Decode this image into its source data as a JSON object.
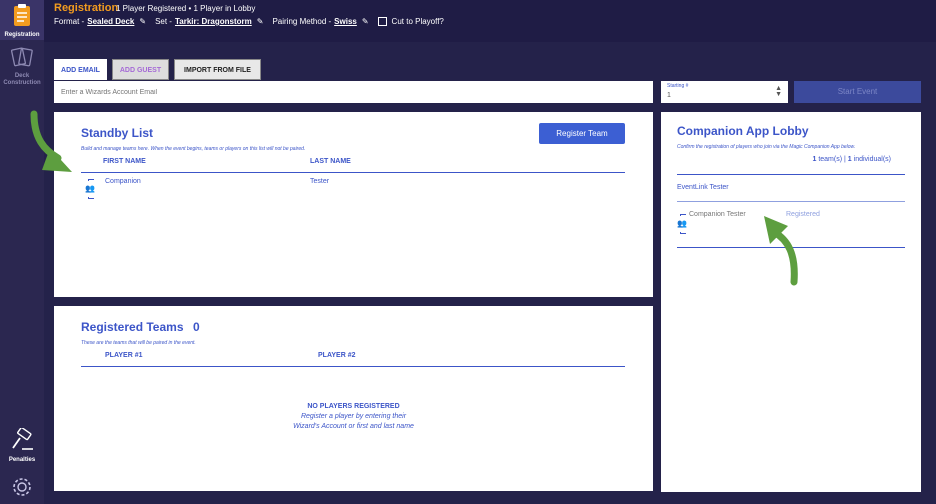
{
  "sidebar": {
    "registration_label": "Registration",
    "deck_label_1": "Deck",
    "deck_label_2": "Construction",
    "penalties_label": "Penalties",
    "icons": [
      "clipboard-icon",
      "cards-icon",
      "gavel-icon",
      "gear-icon"
    ]
  },
  "header": {
    "title": "Registration",
    "subtitle": "1 Player Registered • 1 Player in Lobby",
    "format_label": "Format -",
    "format_value": "Sealed Deck",
    "set_label": "Set -",
    "set_value": "Tarkir: Dragonstorm",
    "pairing_label": "Pairing Method -",
    "pairing_value": "Swiss",
    "cut_label": "Cut to Playoff?"
  },
  "tabs": {
    "email": "ADD EMAIL",
    "guest": "ADD GUEST",
    "file": "IMPORT FROM FILE"
  },
  "email_input": {
    "placeholder": "Enter a Wizards Account Email"
  },
  "starting": {
    "label": "Starting #",
    "value": "1"
  },
  "start_event": "Start Event",
  "standby": {
    "title": "Standby List",
    "description": "Build and manage teams here. When the event begins, teams or players on this list will not be paired.",
    "register_team": "Register Team",
    "col_first": "FIRST NAME",
    "col_last": "LAST NAME",
    "rows": [
      {
        "first": "Companion",
        "last": "Tester"
      }
    ]
  },
  "teams": {
    "title": "Registered Teams",
    "count": "0",
    "description": "These are the teams that will be paired in the event.",
    "col_p1": "PLAYER #1",
    "col_p2": "PLAYER #2",
    "empty_title": "NO PLAYERS REGISTERED",
    "empty_line1": "Register a player by entering their",
    "empty_line2": "Wizard's Account or first and last name"
  },
  "lobby": {
    "title": "Companion App Lobby",
    "description": "Confirm the registration of players who join via the Magic Companion App below.",
    "team_count": "1",
    "team_label": "team(s)",
    "separator": "|",
    "individual_count": "1",
    "individual_label": "individual(s)",
    "team_name": "EventLink Tester",
    "player_name": "Companion Tester",
    "player_status": "Registered"
  },
  "colors": {
    "accent": "#3c55c8",
    "orange": "#f39c1f",
    "arrow": "#5d9e3f",
    "bg": "#24224a"
  }
}
